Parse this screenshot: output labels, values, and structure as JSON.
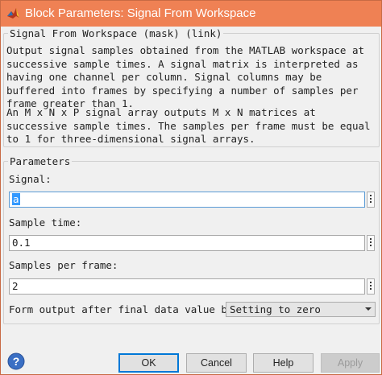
{
  "window": {
    "title": "Block Parameters: Signal From Workspace",
    "icon": "matlab-logo-icon"
  },
  "mask_group": {
    "title": "Signal From Workspace (mask) (link)",
    "description_1": "Output signal samples obtained from the MATLAB workspace at successive sample times.  A signal matrix is interpreted as having one channel per column.  Signal columns may be buffered into frames by specifying a number of samples per frame greater than 1.",
    "description_2": "An M x N x P signal array outputs M x N matrices at successive sample times.  The samples per frame must be equal to 1 for three-dimensional signal arrays."
  },
  "parameters": {
    "title": "Parameters",
    "signal_label": "Signal:",
    "signal_value": "a",
    "sample_time_label": "Sample time:",
    "sample_time_value": "0.1",
    "samples_per_frame_label": "Samples per frame:",
    "samples_per_frame_value": "2",
    "form_output_label": "Form output after final data value by:",
    "form_output_selected": "Setting to zero"
  },
  "buttons": {
    "ok": "OK",
    "cancel": "Cancel",
    "help": "Help",
    "apply": "Apply"
  },
  "icons": {
    "help": "question-mark-icon",
    "more": "vertical-dots-icon",
    "dropdown": "chevron-down-icon"
  },
  "colors": {
    "titlebar": "#ef8154",
    "selection": "#3399ff",
    "help_icon": "#3a6fc4"
  }
}
